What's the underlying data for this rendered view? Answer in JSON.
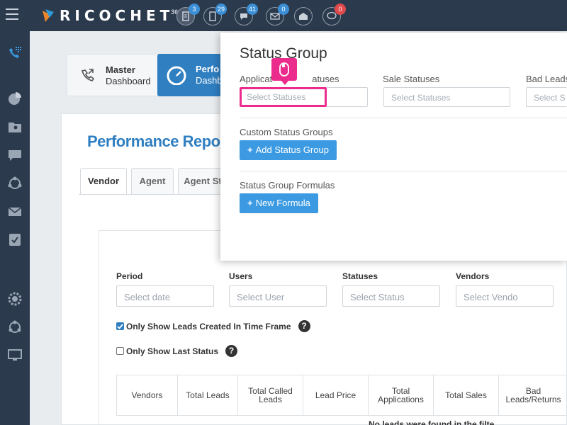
{
  "topbar": {
    "logo_text": "RICOCHET",
    "logo_superscript": "360",
    "icons": [
      {
        "name": "leads-icon",
        "badge": "3"
      },
      {
        "name": "documents-icon",
        "badge": "29"
      },
      {
        "name": "chat-icon",
        "badge": "41"
      },
      {
        "name": "mail-icon",
        "badge": "0"
      },
      {
        "name": "inbox-icon",
        "badge": ""
      },
      {
        "name": "message-icon",
        "badge": "0"
      }
    ]
  },
  "sidebar": {
    "icons": [
      "phone-grid-icon",
      "pie-chart-icon",
      "contacts-icon",
      "chat-icon",
      "integrations-icon",
      "mail-icon",
      "checklist-icon",
      "settings-icon",
      "network-icon",
      "monitor-icon"
    ]
  },
  "dashboard": {
    "master_title": "Master",
    "master_sub": "Dashboard",
    "perf_title": "Perfo",
    "perf_sub": "Dashb"
  },
  "report": {
    "title": "Performance Report",
    "tabs": [
      "Vendor",
      "Agent",
      "Agent St"
    ],
    "filters": {
      "period_label": "Period",
      "period_placeholder": "Select date",
      "users_label": "Users",
      "users_placeholder": "Select User",
      "statuses_label": "Statuses",
      "statuses_placeholder": "Select Status",
      "vendors_label": "Vendors",
      "vendors_placeholder": "Select Vendo"
    },
    "check_time_frame": "Only Show Leads Created In Time Frame",
    "check_last_status": "Only Show Last Status",
    "help": "?",
    "columns": [
      "Vendors",
      "Total Leads",
      "Total Called Leads",
      "Lead Price",
      "Total Applications",
      "Total Sales",
      "Bad Leads/Returns"
    ],
    "empty_text": "No leads were found in the filte"
  },
  "modal": {
    "title": "Status Group",
    "application_label": "Applicat",
    "application_label_tail": "atuses",
    "application_placeholder": "Select Statuses",
    "sale_label": "Sale Statuses",
    "sale_placeholder": "Select Statuses",
    "bad_label": "Bad Leads",
    "bad_placeholder": "Select S",
    "custom_section": "Custom Status Groups",
    "add_group_label": "Add Status Group",
    "formulas_section": "Status Group Formulas",
    "new_formula_label": "New Formula",
    "plus": "+"
  },
  "colors": {
    "topbar": "#2c3a4d",
    "accent": "#2f7fc1",
    "button": "#3b9ae1",
    "highlight": "#ec2c8c"
  }
}
